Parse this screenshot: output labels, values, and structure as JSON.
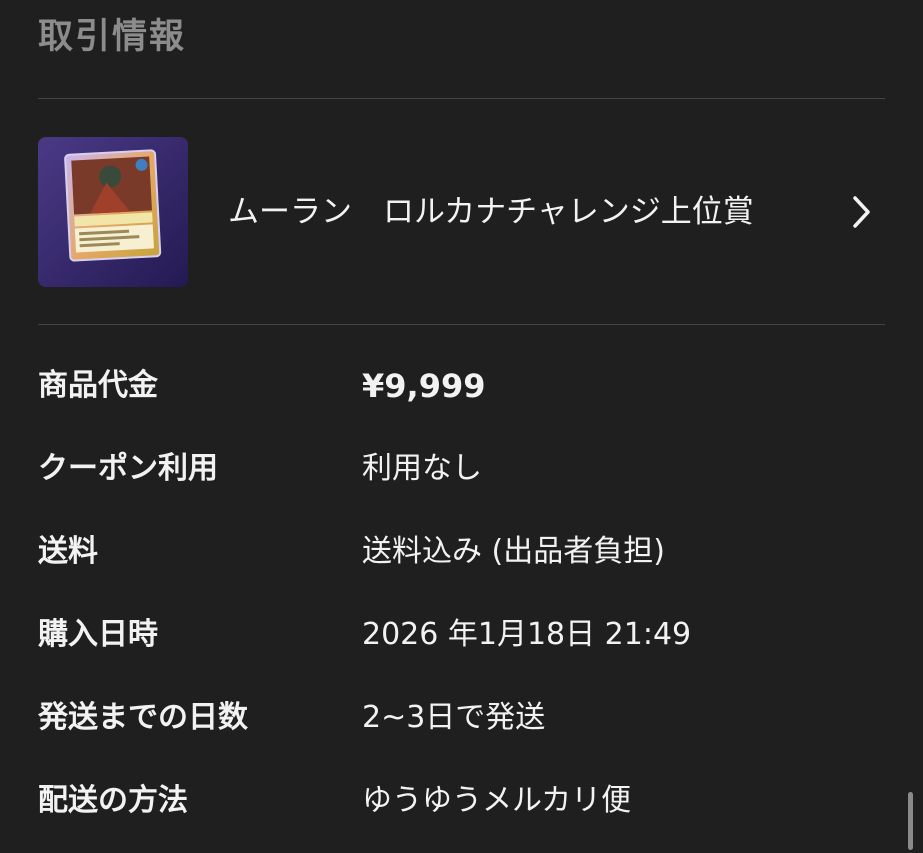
{
  "section": {
    "title": "取引情報"
  },
  "item": {
    "name": "ムーラン　ロルカナチャレンジ上位賞",
    "thumbnail_icon": "trading-card-photo",
    "chevron_icon": "chevron-right-icon"
  },
  "details": [
    {
      "label": "商品代金",
      "value": "¥9,999"
    },
    {
      "label": "クーポン利用",
      "value": "利用なし"
    },
    {
      "label": "送料",
      "value": "送料込み (出品者負担)"
    },
    {
      "label": "購入日時",
      "value": "2026 年1月18日 21:49"
    },
    {
      "label": "発送までの日数",
      "value": "2~3日で発送"
    },
    {
      "label": "配送の方法",
      "value": "ゆうゆうメルカリ便"
    }
  ],
  "colors": {
    "background": "#1f1f1f",
    "text": "#f2f2f2",
    "muted_title": "#8c8c8c",
    "divider": "#444444"
  }
}
